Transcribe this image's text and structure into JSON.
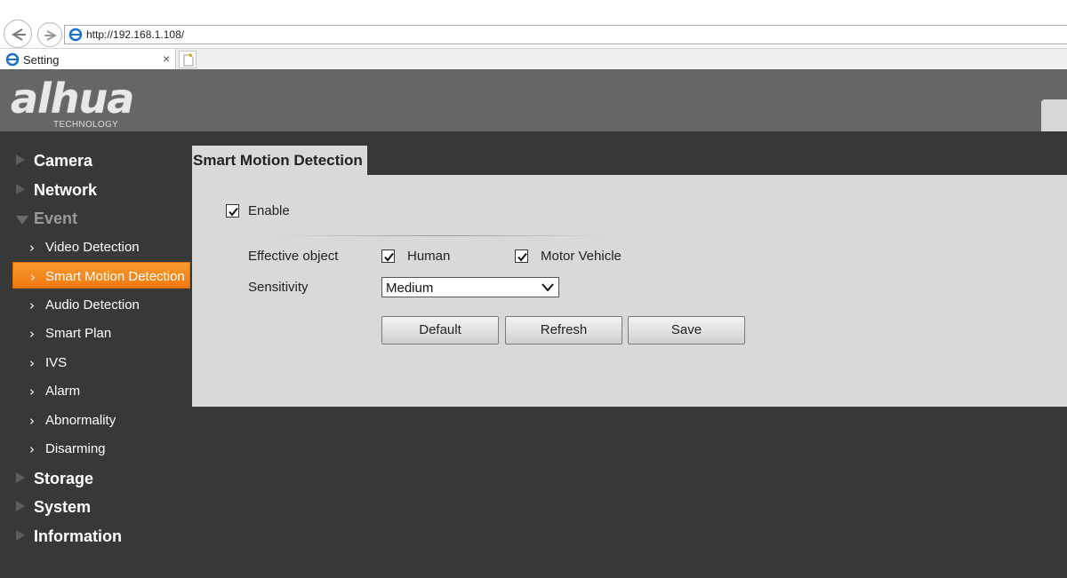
{
  "browser": {
    "url": "http://192.168.1.108/",
    "tab_title": "Setting",
    "tab_close": "×"
  },
  "header": {
    "logo_text": "alhua",
    "logo_subtext": "TECHNOLOGY"
  },
  "sidebar": {
    "categories": [
      {
        "label": "Camera"
      },
      {
        "label": "Network"
      },
      {
        "label": "Event"
      },
      {
        "label": "Storage"
      },
      {
        "label": "System"
      },
      {
        "label": "Information"
      }
    ],
    "event_items": [
      {
        "label": "Video Detection"
      },
      {
        "label": "Smart Motion Detection"
      },
      {
        "label": "Audio Detection"
      },
      {
        "label": "Smart Plan"
      },
      {
        "label": "IVS"
      },
      {
        "label": "Alarm"
      },
      {
        "label": "Abnormality"
      },
      {
        "label": "Disarming"
      }
    ],
    "chevron": "›"
  },
  "content": {
    "tab_title": "Smart Motion Detection",
    "enable_label": "Enable",
    "enable_checked": true,
    "effective_object_label": "Effective object",
    "human_label": "Human",
    "human_checked": true,
    "motor_vehicle_label": "Motor Vehicle",
    "motor_vehicle_checked": true,
    "sensitivity_label": "Sensitivity",
    "sensitivity_value": "Medium",
    "buttons": {
      "default": "Default",
      "refresh": "Refresh",
      "save": "Save"
    }
  },
  "colors": {
    "active_item": "#f07a12",
    "sidebar_bg": "#383838",
    "header_bg": "#666666",
    "panel_bg": "#d9d9d9"
  }
}
